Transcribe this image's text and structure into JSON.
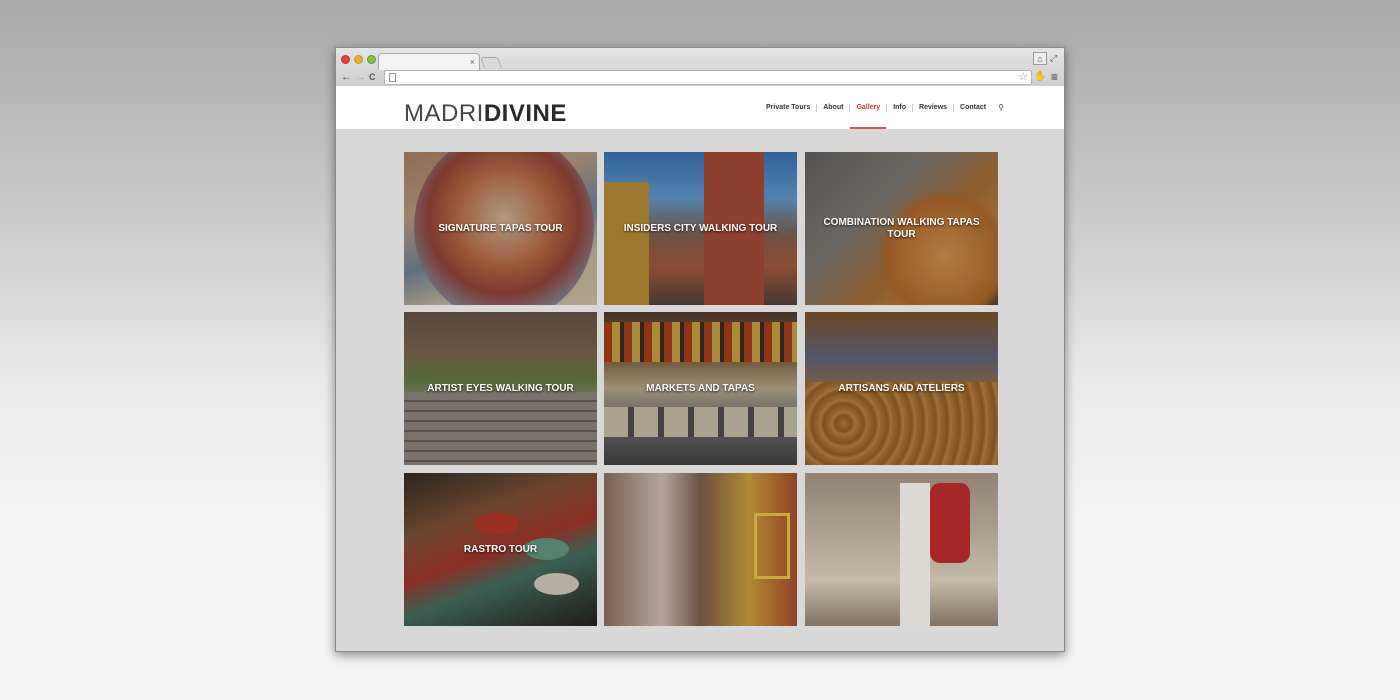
{
  "browser": {
    "tab_close": "×",
    "back": "←",
    "forward": "→",
    "reload": "C",
    "url": "",
    "star": "☆",
    "menu": "≡"
  },
  "site": {
    "logo_light": "MADRI",
    "logo_bold": "DIVINE",
    "nav": [
      {
        "label": "Private Tours",
        "active": false
      },
      {
        "label": "About",
        "active": false
      },
      {
        "label": "Gallery",
        "active": true
      },
      {
        "label": "Info",
        "active": false
      },
      {
        "label": "Reviews",
        "active": false
      },
      {
        "label": "Contact",
        "active": false
      }
    ],
    "accent_color": "#d9534f"
  },
  "gallery": {
    "tiles": [
      {
        "title": "SIGNATURE TAPAS TOUR"
      },
      {
        "title": "INSIDERS CITY WALKING TOUR"
      },
      {
        "title": "COMBINATION WALKING TAPAS TOUR"
      },
      {
        "title": "ARTIST EYES WALKING TOUR"
      },
      {
        "title": "MARKETS AND TAPAS"
      },
      {
        "title": "ARTISANS AND ATELIERS"
      },
      {
        "title": "RASTRO TOUR"
      },
      {
        "title": ""
      },
      {
        "title": ""
      }
    ]
  }
}
